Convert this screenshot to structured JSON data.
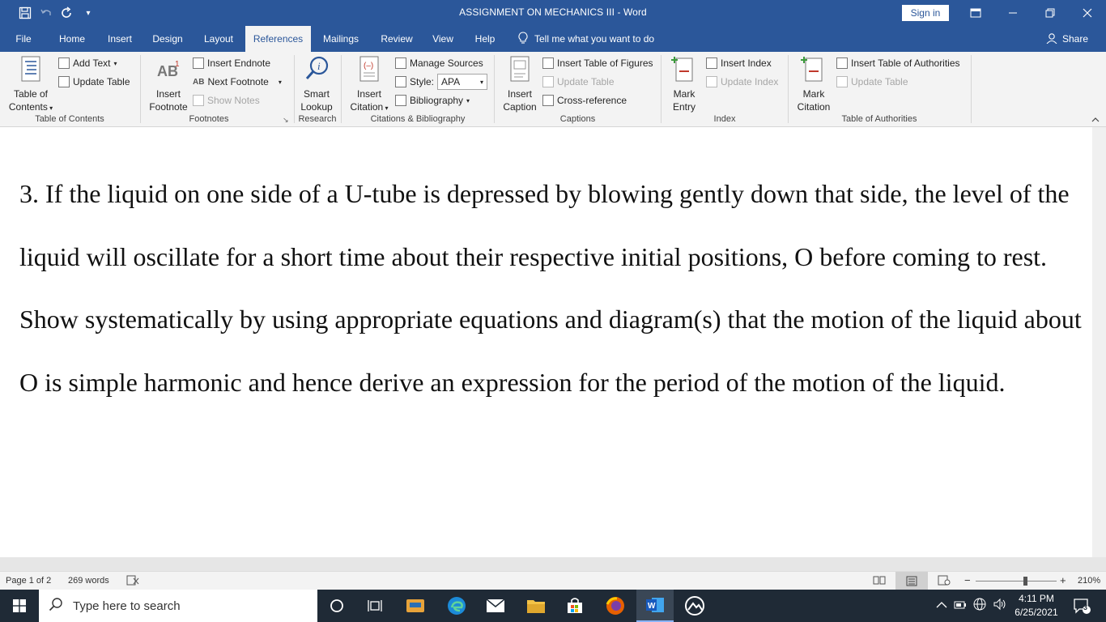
{
  "window": {
    "title": "ASSIGNMENT ON MECHANICS III  -  Word",
    "sign_in": "Sign in"
  },
  "tabs": [
    "File",
    "Home",
    "Insert",
    "Design",
    "Layout",
    "References",
    "Mailings",
    "Review",
    "View",
    "Help"
  ],
  "active_tab": "References",
  "tell_me": "Tell me what you want to do",
  "share": "Share",
  "ribbon": {
    "toc": {
      "table_of_contents_l1": "Table of",
      "table_of_contents_l2": "Contents",
      "add_text": "Add Text",
      "update_table": "Update Table",
      "group": "Table of Contents"
    },
    "footnotes": {
      "insert_footnote_l1": "Insert",
      "insert_footnote_l2": "Footnote",
      "insert_endnote": "Insert Endnote",
      "next_footnote": "Next Footnote",
      "show_notes": "Show Notes",
      "group": "Footnotes"
    },
    "research": {
      "smart_lookup_l1": "Smart",
      "smart_lookup_l2": "Lookup",
      "group": "Research"
    },
    "citations": {
      "insert_citation_l1": "Insert",
      "insert_citation_l2": "Citation",
      "manage_sources": "Manage Sources",
      "style_label": "Style:",
      "style_value": "APA",
      "bibliography": "Bibliography",
      "group": "Citations & Bibliography"
    },
    "captions": {
      "insert_caption_l1": "Insert",
      "insert_caption_l2": "Caption",
      "insert_table_of_figures": "Insert Table of Figures",
      "update_table": "Update Table",
      "cross_reference": "Cross-reference",
      "group": "Captions"
    },
    "index": {
      "mark_entry_l1": "Mark",
      "mark_entry_l2": "Entry",
      "insert_index": "Insert Index",
      "update_index": "Update Index",
      "group": "Index"
    },
    "authorities": {
      "mark_citation_l1": "Mark",
      "mark_citation_l2": "Citation",
      "insert_table_of_authorities": "Insert Table of Authorities",
      "update_table": "Update Table",
      "group": "Table of Authorities"
    }
  },
  "document": {
    "paragraph": "3. If the liquid on one side of a U-tube is depressed by blowing gently down that side, the level of the liquid will oscillate for a short time about their respective initial positions, O before coming to rest. Show systematically by using appropriate equations and diagram(s) that the motion of the liquid about O is simple harmonic and hence derive an expression for the period of the motion of the liquid."
  },
  "status": {
    "page": "Page 1 of 2",
    "words": "269 words",
    "zoom": "210%"
  },
  "taskbar": {
    "search_placeholder": "Type here to search",
    "time": "4:11 PM",
    "date": "6/25/2021",
    "notification_count": "3"
  },
  "colors": {
    "word_blue": "#2b579a",
    "ribbon_bg": "#f3f3f3",
    "taskbar_bg": "#1f2a36"
  }
}
